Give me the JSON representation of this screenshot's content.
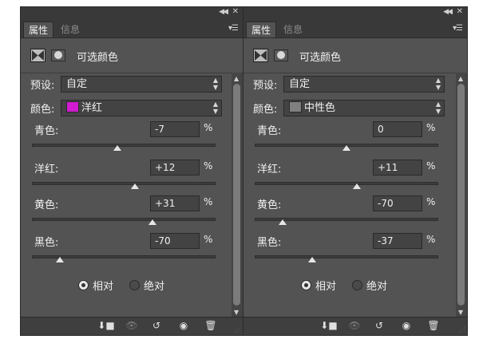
{
  "panels": [
    {
      "tabs": {
        "active": "属性",
        "inactive": "信息"
      },
      "title": "可选颜色",
      "preset": {
        "label": "预设:",
        "value": "自定"
      },
      "colors": {
        "label": "颜色:",
        "value": "洋红",
        "swatch": "#d11bd1"
      },
      "sliders": [
        {
          "label": "青色:",
          "value": "-7",
          "unit": "%",
          "level": -7
        },
        {
          "label": "洋红:",
          "value": "+12",
          "unit": "%",
          "level": 12
        },
        {
          "label": "黄色:",
          "value": "+31",
          "unit": "%",
          "level": 31
        },
        {
          "label": "黑色:",
          "value": "-70",
          "unit": "%",
          "level": -70
        }
      ],
      "method": {
        "relative": "相对",
        "absolute": "绝对",
        "selected": "relative"
      }
    },
    {
      "tabs": {
        "active": "属性",
        "inactive": "信息"
      },
      "title": "可选颜色",
      "preset": {
        "label": "预设:",
        "value": "自定"
      },
      "colors": {
        "label": "颜色:",
        "value": "中性色",
        "swatch": "#808080"
      },
      "sliders": [
        {
          "label": "青色:",
          "value": "0",
          "unit": "%",
          "level": 0
        },
        {
          "label": "洋红:",
          "value": "+11",
          "unit": "%",
          "level": 11
        },
        {
          "label": "黄色:",
          "value": "-70",
          "unit": "%",
          "level": -70
        },
        {
          "label": "黑色:",
          "value": "-37",
          "unit": "%",
          "level": -37
        }
      ],
      "method": {
        "relative": "相对",
        "absolute": "绝对",
        "selected": "relative"
      }
    }
  ],
  "icons": {
    "collapse": "double-chevron-left-icon",
    "close": "close-icon",
    "menu": "panel-menu-icon",
    "footer": [
      "clip-to-layer-icon",
      "view-previous-icon",
      "reset-icon",
      "visibility-eye-icon",
      "trash-icon"
    ]
  }
}
